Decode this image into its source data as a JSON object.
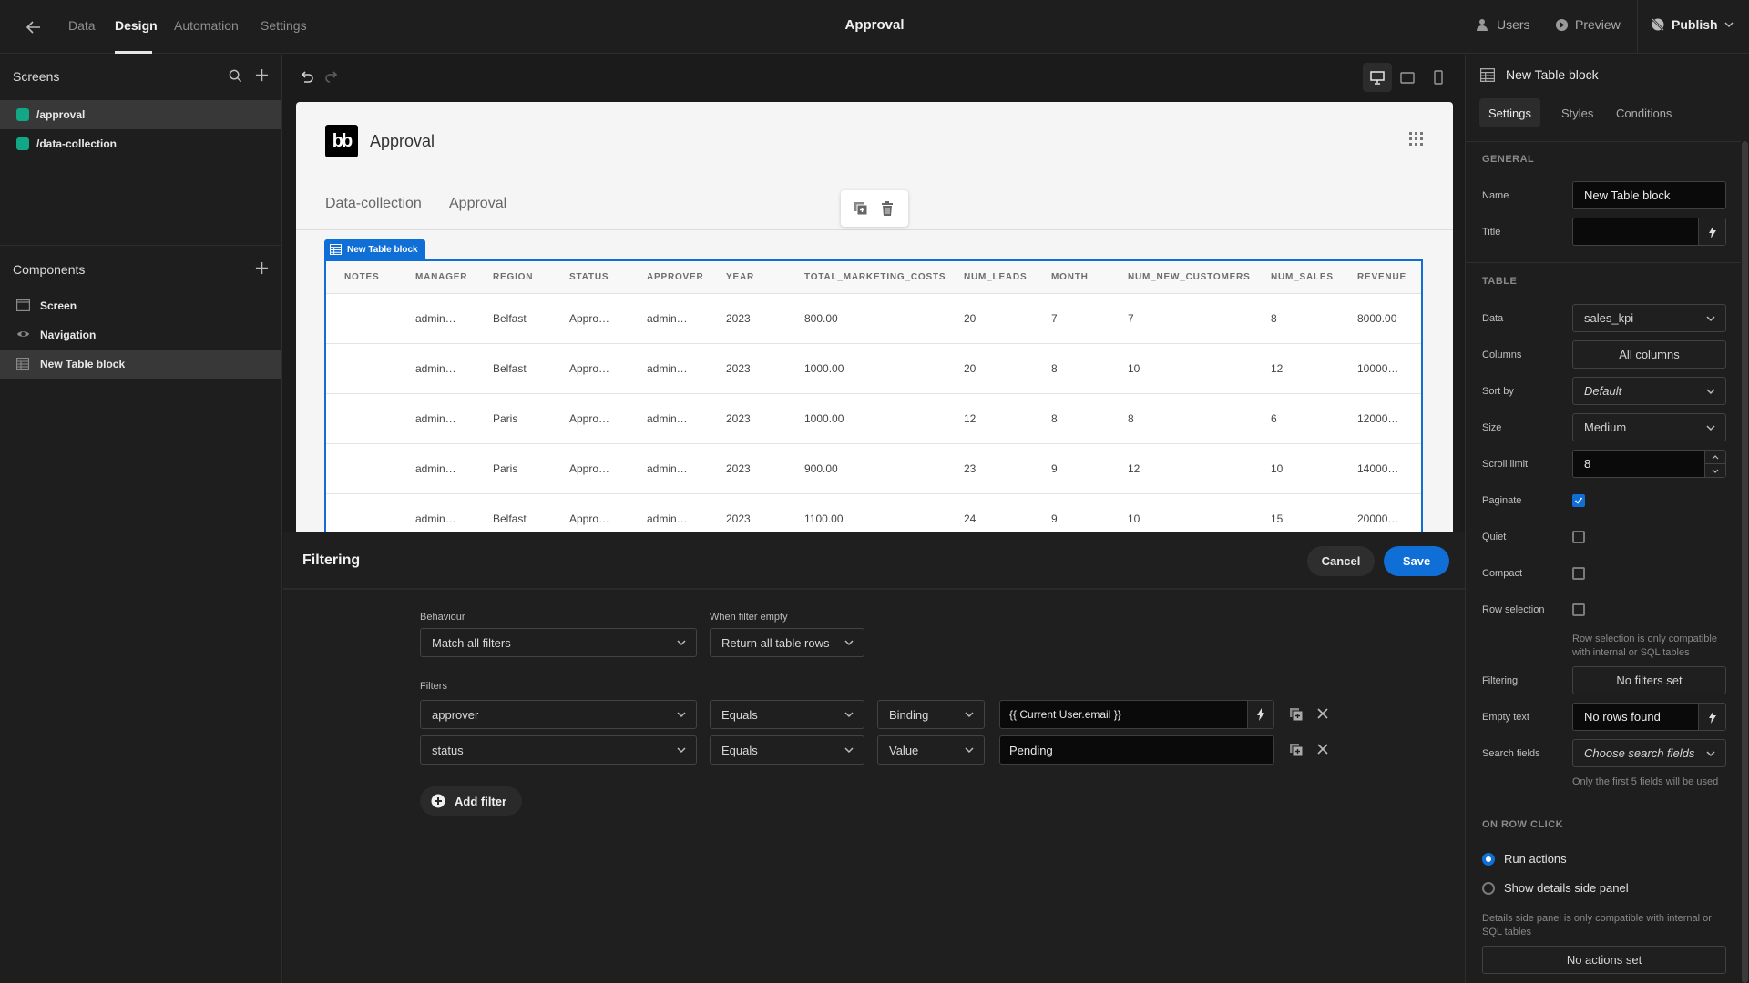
{
  "topbar": {
    "tabs": [
      "Data",
      "Design",
      "Automation",
      "Settings"
    ],
    "active_tab": "Design",
    "app_title": "Approval",
    "users_label": "Users",
    "preview_label": "Preview",
    "publish_label": "Publish"
  },
  "screens": {
    "title": "Screens",
    "items": [
      {
        "label": "/approval",
        "selected": true,
        "color": "#12a886"
      },
      {
        "label": "/data-collection",
        "selected": false,
        "color": "#12a886"
      }
    ]
  },
  "components": {
    "title": "Components",
    "items": [
      {
        "label": "Screen",
        "icon": "screen-icon"
      },
      {
        "label": "Navigation",
        "icon": "eye-icon"
      },
      {
        "label": "New Table block",
        "icon": "table-icon",
        "selected": true
      }
    ]
  },
  "preview": {
    "logo_text": "bb",
    "site_title": "Approval",
    "nav": [
      "Data-collection",
      "Approval"
    ],
    "block_label": "New Table block",
    "table": {
      "columns": [
        "NOTES",
        "MANAGER",
        "REGION",
        "STATUS",
        "APPROVER",
        "YEAR",
        "TOTAL_MARKETING_COSTS",
        "NUM_LEADS",
        "MONTH",
        "NUM_NEW_CUSTOMERS",
        "NUM_SALES",
        "REVENUE"
      ],
      "rows": [
        [
          "",
          "admin…",
          "Belfast",
          "Appro…",
          "admin…",
          "2023",
          "800.00",
          "20",
          "7",
          "7",
          "8",
          "8000.00"
        ],
        [
          "",
          "admin…",
          "Belfast",
          "Appro…",
          "admin…",
          "2023",
          "1000.00",
          "20",
          "8",
          "10",
          "12",
          "10000…"
        ],
        [
          "",
          "admin…",
          "Paris",
          "Appro…",
          "admin…",
          "2023",
          "1000.00",
          "12",
          "8",
          "8",
          "6",
          "12000…"
        ],
        [
          "",
          "admin…",
          "Paris",
          "Appro…",
          "admin…",
          "2023",
          "900.00",
          "23",
          "9",
          "12",
          "10",
          "14000…"
        ],
        [
          "",
          "admin…",
          "Belfast",
          "Appro…",
          "admin…",
          "2023",
          "1100.00",
          "24",
          "9",
          "10",
          "15",
          "20000…"
        ]
      ]
    }
  },
  "filtering": {
    "title": "Filtering",
    "cancel_label": "Cancel",
    "save_label": "Save",
    "behaviour_label": "Behaviour",
    "behaviour_value": "Match all filters",
    "when_empty_label": "When filter empty",
    "when_empty_value": "Return all table rows",
    "filters_label": "Filters",
    "filters": [
      {
        "field": "approver",
        "operator": "Equals",
        "type": "Binding",
        "value": "{{ Current User.email }}"
      },
      {
        "field": "status",
        "operator": "Equals",
        "type": "Value",
        "value": "Pending"
      }
    ],
    "add_filter_label": "Add filter"
  },
  "settings_panel": {
    "title": "New Table block",
    "tabs": [
      "Settings",
      "Styles",
      "Conditions"
    ],
    "active_tab": "Settings",
    "general": {
      "heading": "GENERAL",
      "name_label": "Name",
      "name_value": "New Table block",
      "title_label": "Title",
      "title_value": ""
    },
    "table": {
      "heading": "TABLE",
      "data_label": "Data",
      "data_value": "sales_kpi",
      "columns_label": "Columns",
      "columns_value": "All columns",
      "sort_label": "Sort by",
      "sort_value": "Default",
      "size_label": "Size",
      "size_value": "Medium",
      "scroll_label": "Scroll limit",
      "scroll_value": "8",
      "paginate_label": "Paginate",
      "paginate": true,
      "quiet_label": "Quiet",
      "quiet": false,
      "compact_label": "Compact",
      "compact": false,
      "row_selection_label": "Row selection",
      "row_selection": false,
      "row_selection_help": "Row selection is only compatible with internal or SQL tables",
      "filtering_label": "Filtering",
      "filtering_value": "No filters set",
      "empty_text_label": "Empty text",
      "empty_text_value": "No rows found",
      "search_fields_label": "Search fields",
      "search_fields_placeholder": "Choose search fields",
      "search_fields_help": "Only the first 5 fields will be used"
    },
    "row_click": {
      "heading": "ON ROW CLICK",
      "options": [
        "Run actions",
        "Show details side panel"
      ],
      "selected": "Run actions",
      "help": "Details side panel is only compatible with internal or SQL tables",
      "actions_value": "No actions set"
    }
  }
}
